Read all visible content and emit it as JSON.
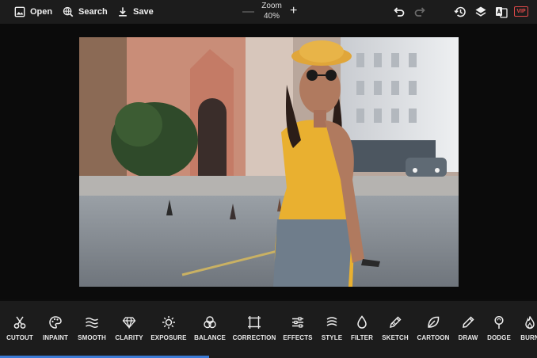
{
  "topbar": {
    "open_label": "Open",
    "search_label": "Search",
    "save_label": "Save",
    "zoom_label": "Zoom",
    "zoom_value": "40%",
    "vip_label": "VIP",
    "icons": [
      "undo-icon",
      "redo-icon",
      "history-icon",
      "layers-icon",
      "translate-icon"
    ]
  },
  "canvas": {
    "photo": "street-portrait-woman-yellow-hat"
  },
  "tools": [
    {
      "label": "CUTOUT",
      "icon": "scissors-icon"
    },
    {
      "label": "INPAINT",
      "icon": "palette-icon"
    },
    {
      "label": "SMOOTH",
      "icon": "waves-icon"
    },
    {
      "label": "CLARITY",
      "icon": "diamond-icon"
    },
    {
      "label": "EXPOSURE",
      "icon": "sun-icon"
    },
    {
      "label": "BALANCE",
      "icon": "rgb-circles-icon"
    },
    {
      "label": "CORRECTION",
      "icon": "crop-frame-icon"
    },
    {
      "label": "EFFECTS",
      "icon": "sliders-icon"
    },
    {
      "label": "STYLE",
      "icon": "style-brush-icon"
    },
    {
      "label": "FILTER",
      "icon": "drop-icon"
    },
    {
      "label": "SKETCH",
      "icon": "pencil-sketch-icon"
    },
    {
      "label": "CARTOON",
      "icon": "leaf-icon"
    },
    {
      "label": "DRAW",
      "icon": "pen-icon"
    },
    {
      "label": "DODGE",
      "icon": "lollipop-icon"
    },
    {
      "label": "BURN",
      "icon": "flame-icon"
    }
  ],
  "colors": {
    "bar": "#1c1c1c",
    "background": "#0b0b0b",
    "vip": "#e24a4a",
    "progress": "#3b7bd6"
  }
}
